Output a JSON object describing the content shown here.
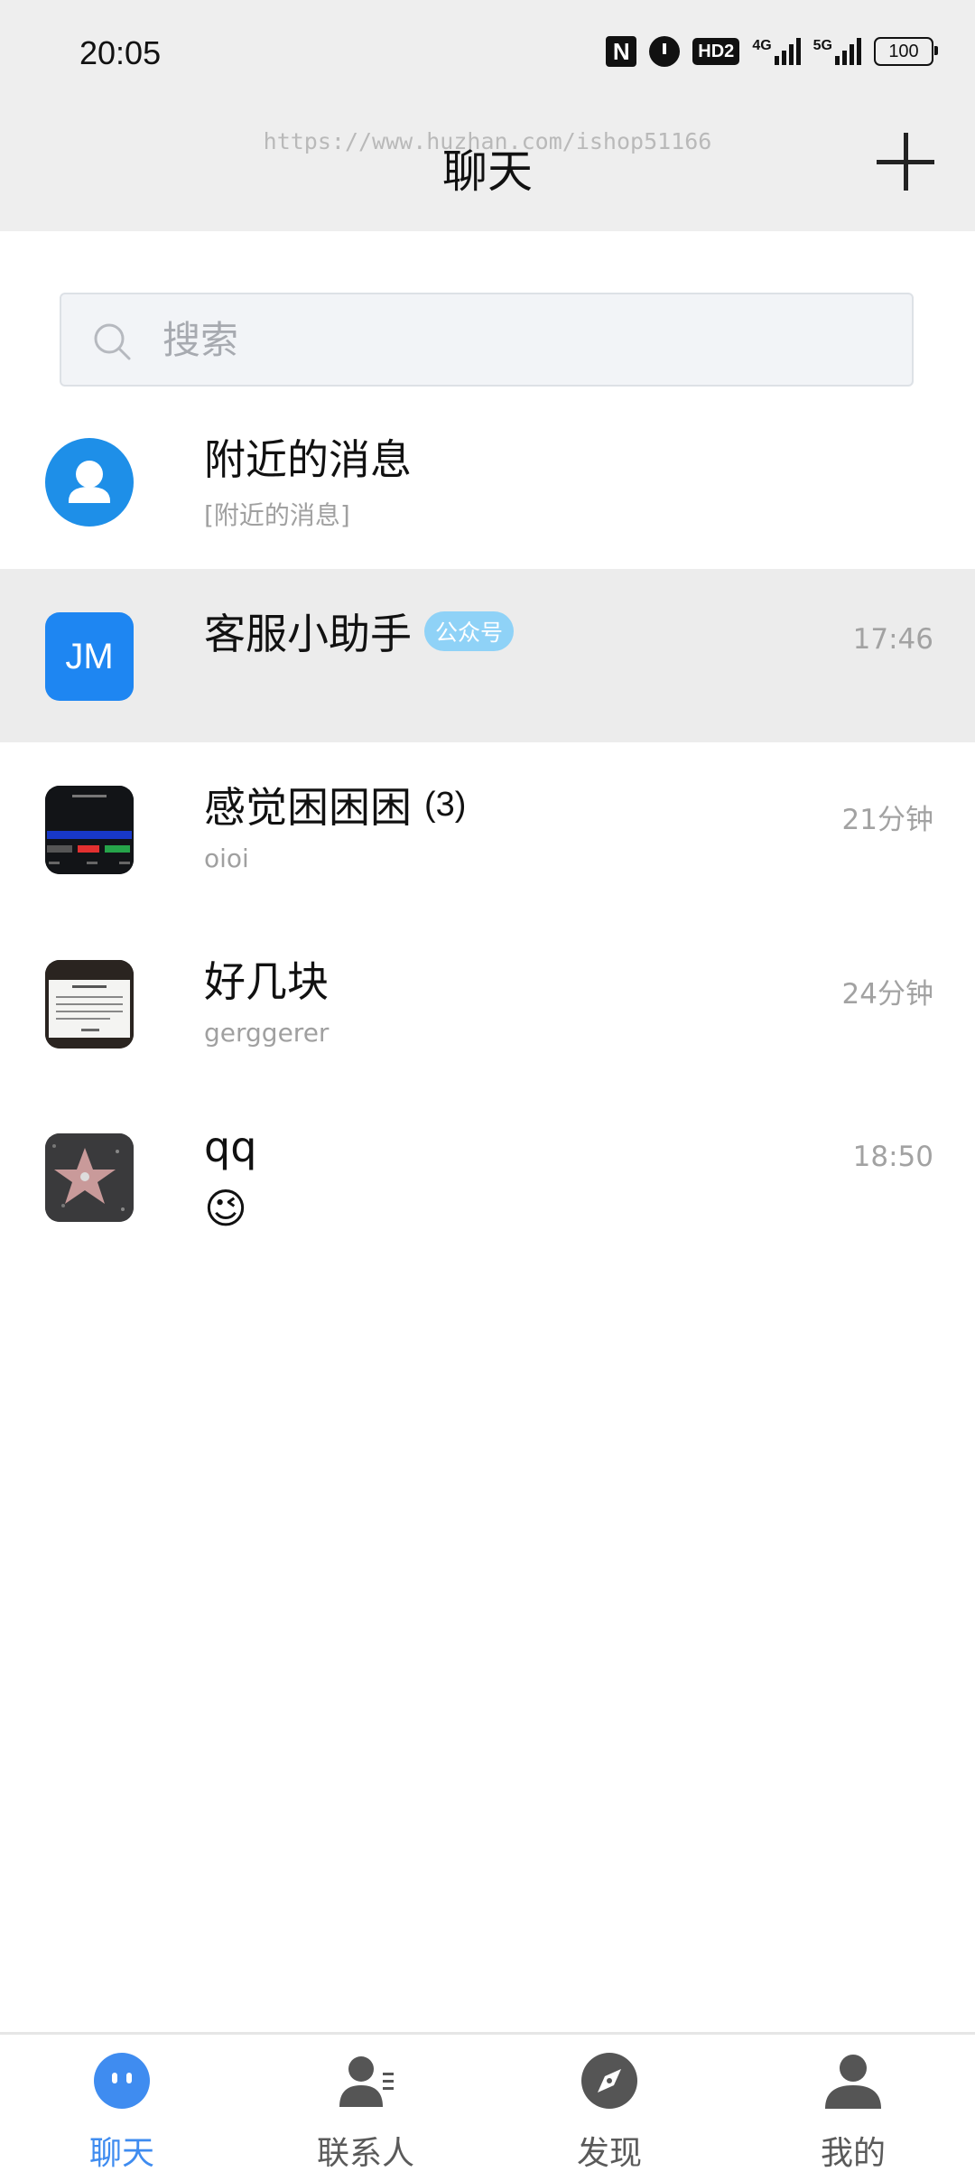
{
  "status_bar": {
    "time": "20:05",
    "icons": [
      "nfc-icon",
      "alarm-icon",
      "hd-icon",
      "signal-4g-icon",
      "signal-5g-icon",
      "battery-icon"
    ],
    "hd_label": "HD2",
    "network_4g": "4G",
    "network_5g": "5G",
    "battery": "100"
  },
  "header": {
    "title": "聊天",
    "watermark": "https://www.huzhan.com/ishop51166",
    "add_icon": "plus-icon"
  },
  "search": {
    "placeholder": "搜索",
    "icon": "search-icon"
  },
  "chats": [
    {
      "name": "附近的消息",
      "preview": "[附近的消息]",
      "time": "",
      "avatar": "person-icon"
    },
    {
      "name": "客服小助手",
      "badge": "公众号",
      "preview": "",
      "time": "17:46",
      "avatar_text": "JM"
    },
    {
      "name": "感觉困困困",
      "count": "(3)",
      "preview": "oioi",
      "time": "21分钟",
      "avatar": "screenshot-thumbnail"
    },
    {
      "name": "好几块",
      "preview": "gerggerer",
      "time": "24分钟",
      "avatar": "note-thumbnail"
    },
    {
      "name": "qq",
      "preview": "😉",
      "time": "18:50",
      "avatar": "star-thumbnail"
    }
  ],
  "bottom_nav": {
    "tabs": [
      {
        "label": "聊天",
        "icon": "chat-bubble-icon",
        "active": true
      },
      {
        "label": "联系人",
        "icon": "contacts-icon",
        "active": false
      },
      {
        "label": "发现",
        "icon": "compass-icon",
        "active": false
      },
      {
        "label": "我的",
        "icon": "profile-icon",
        "active": false
      }
    ]
  },
  "colors": {
    "accent": "#3f8cf0",
    "header_bg": "#eeeeee",
    "highlight_row": "#ececec",
    "badge": "#8fd2f7"
  }
}
